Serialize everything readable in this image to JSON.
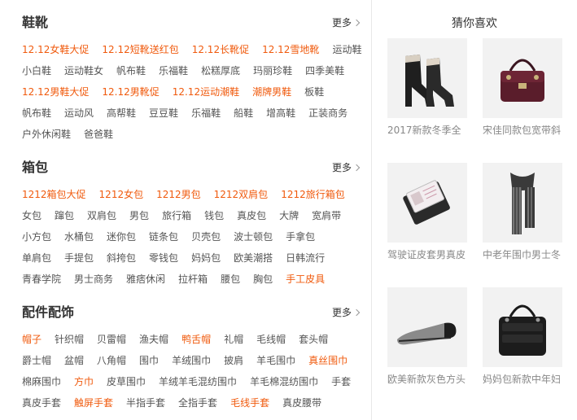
{
  "sections": [
    {
      "title": "鞋靴",
      "more_label": "更多",
      "rows": [
        [
          {
            "t": "12.12女鞋大促",
            "hot": true
          },
          {
            "t": "12.12短靴送红包",
            "hot": true
          },
          {
            "t": "12.12长靴促",
            "hot": true
          },
          {
            "t": "12.12雪地靴",
            "hot": true
          },
          {
            "t": "运动鞋",
            "hot": false
          }
        ],
        [
          {
            "t": "小白鞋",
            "hot": false
          },
          {
            "t": "运动鞋女",
            "hot": false
          },
          {
            "t": "帆布鞋",
            "hot": false
          },
          {
            "t": "乐福鞋",
            "hot": false
          },
          {
            "t": "松糕厚底",
            "hot": false
          },
          {
            "t": "玛丽珍鞋",
            "hot": false
          },
          {
            "t": "四季美鞋",
            "hot": false
          }
        ],
        [
          {
            "t": "12.12男鞋大促",
            "hot": true
          },
          {
            "t": "12.12男靴促",
            "hot": true
          },
          {
            "t": "12.12运动潮鞋",
            "hot": true
          },
          {
            "t": "潮牌男鞋",
            "hot": true
          },
          {
            "t": "板鞋",
            "hot": false
          }
        ],
        [
          {
            "t": "帆布鞋",
            "hot": false
          },
          {
            "t": "运动风",
            "hot": false
          },
          {
            "t": "高帮鞋",
            "hot": false
          },
          {
            "t": "豆豆鞋",
            "hot": false
          },
          {
            "t": "乐福鞋",
            "hot": false
          },
          {
            "t": "船鞋",
            "hot": false
          },
          {
            "t": "增高鞋",
            "hot": false
          },
          {
            "t": "正装商务",
            "hot": false
          }
        ],
        [
          {
            "t": "户外休闲鞋",
            "hot": false
          },
          {
            "t": "爸爸鞋",
            "hot": false
          }
        ]
      ]
    },
    {
      "title": "箱包",
      "more_label": "更多",
      "rows": [
        [
          {
            "t": "1212箱包大促",
            "hot": true
          },
          {
            "t": "1212女包",
            "hot": true
          },
          {
            "t": "1212男包",
            "hot": true
          },
          {
            "t": "1212双肩包",
            "hot": true
          },
          {
            "t": "1212旅行箱包",
            "hot": true
          }
        ],
        [
          {
            "t": "女包",
            "hot": false
          },
          {
            "t": "蹿包",
            "hot": false
          },
          {
            "t": "双肩包",
            "hot": false
          },
          {
            "t": "男包",
            "hot": false
          },
          {
            "t": "旅行箱",
            "hot": false
          },
          {
            "t": "钱包",
            "hot": false
          },
          {
            "t": "真皮包",
            "hot": false
          },
          {
            "t": "大牌",
            "hot": false
          },
          {
            "t": "宽肩带",
            "hot": false
          }
        ],
        [
          {
            "t": "小方包",
            "hot": false
          },
          {
            "t": "水桶包",
            "hot": false
          },
          {
            "t": "迷你包",
            "hot": false
          },
          {
            "t": "链条包",
            "hot": false
          },
          {
            "t": "贝壳包",
            "hot": false
          },
          {
            "t": "波士顿包",
            "hot": false
          },
          {
            "t": "手拿包",
            "hot": false
          }
        ],
        [
          {
            "t": "单肩包",
            "hot": false
          },
          {
            "t": "手提包",
            "hot": false
          },
          {
            "t": "斜挎包",
            "hot": false
          },
          {
            "t": "零钱包",
            "hot": false
          },
          {
            "t": "妈妈包",
            "hot": false
          },
          {
            "t": "欧美潮搭",
            "hot": false
          },
          {
            "t": "日韩流行",
            "hot": false
          }
        ],
        [
          {
            "t": "青春学院",
            "hot": false
          },
          {
            "t": "男士商务",
            "hot": false
          },
          {
            "t": "雅痞休闲",
            "hot": false
          },
          {
            "t": "拉杆箱",
            "hot": false
          },
          {
            "t": "腰包",
            "hot": false
          },
          {
            "t": "胸包",
            "hot": false
          },
          {
            "t": "手工皮具",
            "hot": true
          }
        ]
      ]
    },
    {
      "title": "配件配饰",
      "more_label": "更多",
      "rows": [
        [
          {
            "t": "帽子",
            "hot": true
          },
          {
            "t": "针织帽",
            "hot": false
          },
          {
            "t": "贝雷帽",
            "hot": false
          },
          {
            "t": "渔夫帽",
            "hot": false
          },
          {
            "t": "鸭舌帽",
            "hot": true
          },
          {
            "t": "礼帽",
            "hot": false
          },
          {
            "t": "毛线帽",
            "hot": false
          },
          {
            "t": "套头帽",
            "hot": false
          }
        ],
        [
          {
            "t": "爵士帽",
            "hot": false
          },
          {
            "t": "盆帽",
            "hot": false
          },
          {
            "t": "八角帽",
            "hot": false
          },
          {
            "t": "围巾",
            "hot": false
          },
          {
            "t": "羊绒围巾",
            "hot": false
          },
          {
            "t": "披肩",
            "hot": false
          },
          {
            "t": "羊毛围巾",
            "hot": false
          },
          {
            "t": "真丝围巾",
            "hot": true
          }
        ],
        [
          {
            "t": "棉麻围巾",
            "hot": false
          },
          {
            "t": "方巾",
            "hot": true
          },
          {
            "t": "皮草围巾",
            "hot": false
          },
          {
            "t": "羊绒羊毛混纺围巾",
            "hot": false
          },
          {
            "t": "羊毛棉混纺围巾",
            "hot": false
          },
          {
            "t": "手套",
            "hot": false
          }
        ],
        [
          {
            "t": "真皮手套",
            "hot": false
          },
          {
            "t": "触屏手套",
            "hot": true
          },
          {
            "t": "半指手套",
            "hot": false
          },
          {
            "t": "全指手套",
            "hot": false
          },
          {
            "t": "毛线手套",
            "hot": true
          },
          {
            "t": "真皮腰带",
            "hot": false
          }
        ]
      ]
    }
  ],
  "recommend": {
    "title": "猜你喜欢",
    "items": [
      {
        "text": "2017新款冬季全",
        "icon": "ankle-boot"
      },
      {
        "text": "宋佳同款包宽带斜",
        "icon": "handbag"
      },
      {
        "text": "驾驶证皮套男真皮",
        "icon": "license-wallet"
      },
      {
        "text": "中老年围巾男士冬",
        "icon": "scarf"
      },
      {
        "text": "欧美新款灰色方头",
        "icon": "flat-shoe"
      },
      {
        "text": "妈妈包新款中年妇",
        "icon": "shoulder-bag"
      }
    ]
  },
  "colors": {
    "hot": "#f05a0d",
    "normal": "#555555",
    "title": "#333333",
    "caption": "#888888"
  }
}
